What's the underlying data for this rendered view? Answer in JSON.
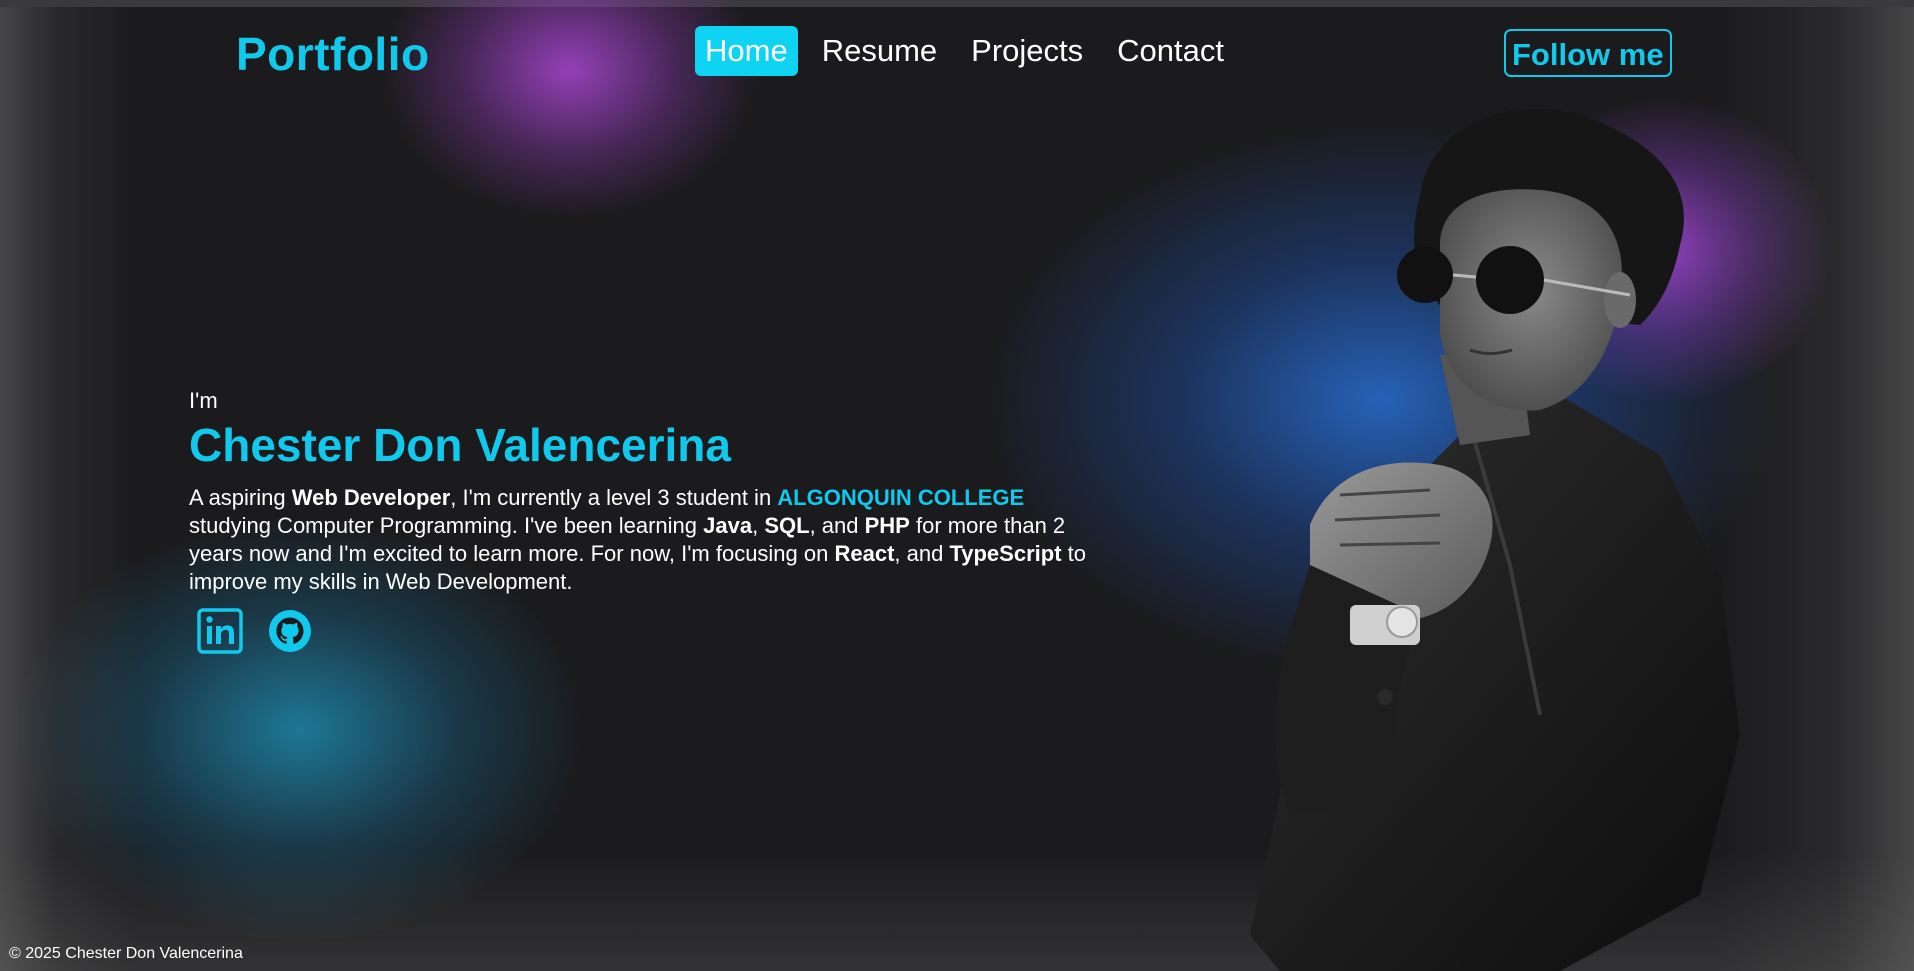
{
  "nav": {
    "brand": "Portfolio",
    "links": [
      {
        "label": "Home",
        "active": true
      },
      {
        "label": "Resume",
        "active": false
      },
      {
        "label": "Projects",
        "active": false
      },
      {
        "label": "Contact",
        "active": false
      }
    ],
    "follow_label": "Follow me"
  },
  "hero": {
    "intro": "I'm",
    "name": "Chester Don Valencerina",
    "bio": {
      "p1": "A aspiring ",
      "role": "Web Developer",
      "p2": ", I'm currently a level 3 student in ",
      "college": "ALGONQUIN COLLEGE",
      "p3": " studying Computer Programming. I've been learning ",
      "lang1": "Java",
      "sep1": ", ",
      "lang2": "SQL",
      "sep2": ", and ",
      "lang3": "PHP",
      "p4": " for more than 2 years now and I'm excited to learn more. For now, I'm focusing on ",
      "focus1": "React",
      "sep3": ", and ",
      "focus2": "TypeScript",
      "p5": " to improve my skills in Web Development."
    }
  },
  "socials": [
    {
      "icon": "linkedin-icon"
    },
    {
      "icon": "github-icon"
    }
  ],
  "footer": {
    "copyright": "© 2025 Chester Don Valencerina"
  },
  "colors": {
    "accent": "#11c9ec",
    "active_bg": "#0fd3f2",
    "background": "#1b1b1d"
  }
}
